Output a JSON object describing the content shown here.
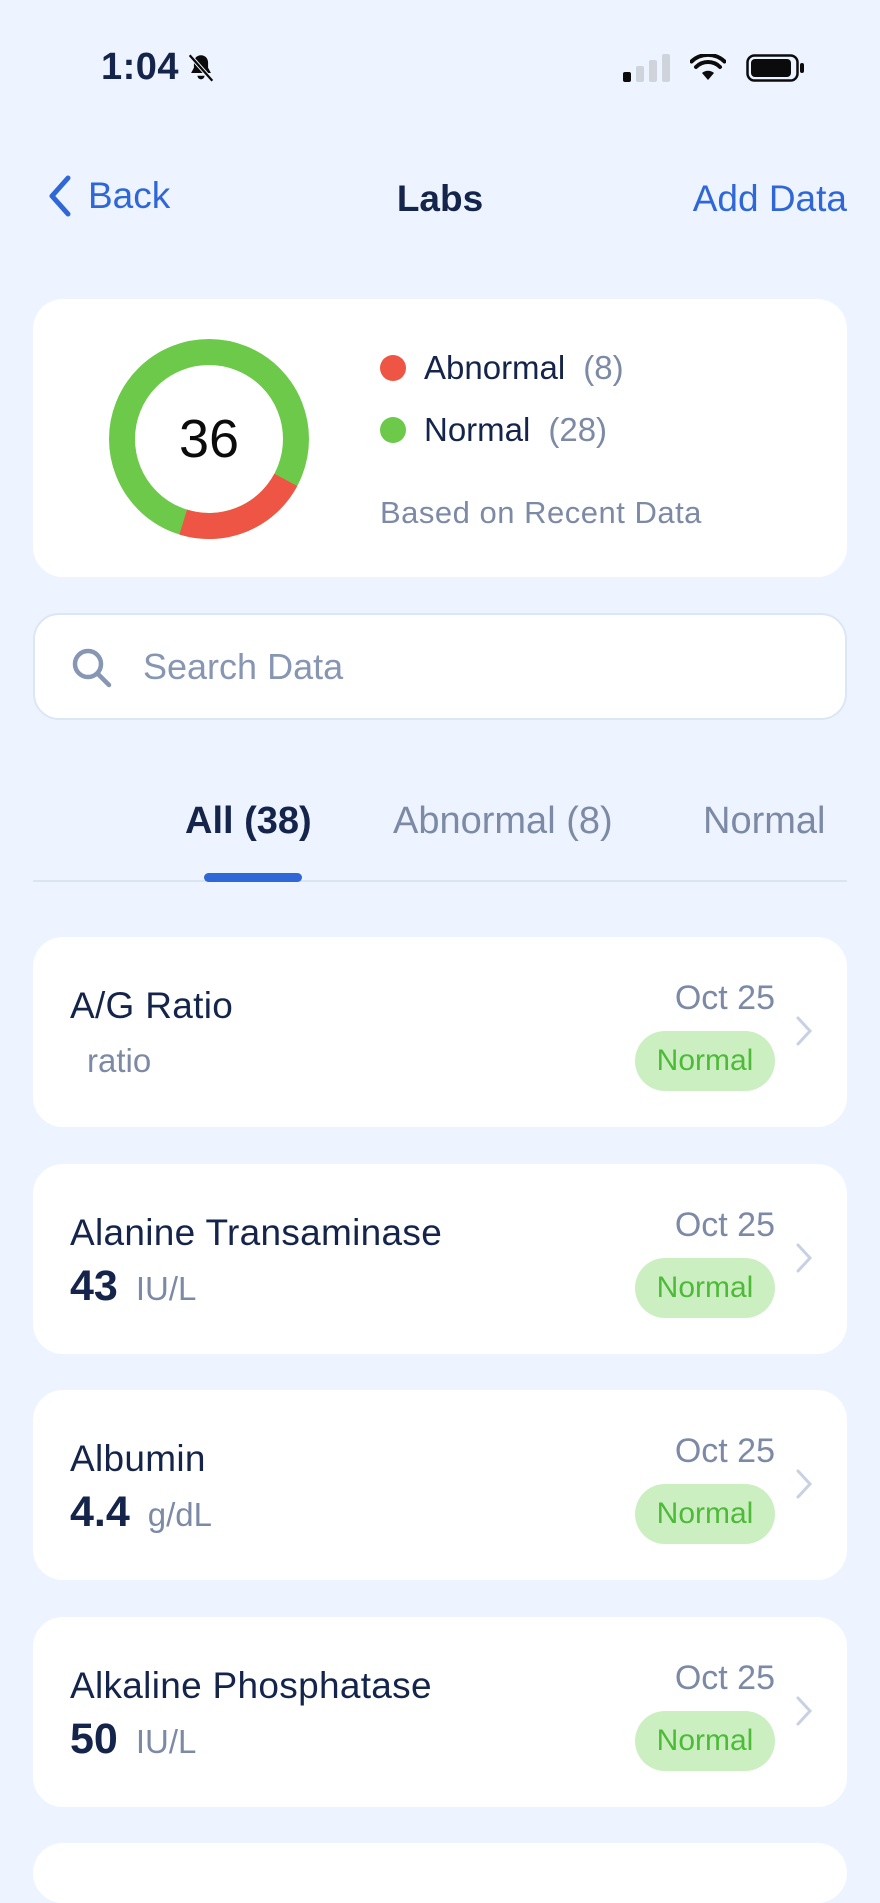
{
  "status": {
    "time": "1:04"
  },
  "nav": {
    "back_label": "Back",
    "title": "Labs",
    "add_label": "Add Data"
  },
  "summary": {
    "total": "36",
    "abnormal_label": "Abnormal",
    "abnormal_count": "(8)",
    "normal_label": "Normal",
    "normal_count": "(28)",
    "note": "Based on Recent Data",
    "abnormal_fraction": 0.22,
    "colors": {
      "abnormal": "#ef5545",
      "normal": "#6cc94a"
    }
  },
  "search": {
    "placeholder": "Search Data"
  },
  "tabs": [
    {
      "label": "All (38)",
      "active": true
    },
    {
      "label": "Abnormal (8)",
      "active": false
    },
    {
      "label": "Normal",
      "active": false
    }
  ],
  "labs": [
    {
      "name": "A/G Ratio",
      "value": "",
      "unit": "ratio",
      "date": "Oct 25",
      "status": "Normal"
    },
    {
      "name": "Alanine Transaminase",
      "value": "43",
      "unit": "IU/L",
      "date": "Oct 25",
      "status": "Normal"
    },
    {
      "name": "Albumin",
      "value": "4.4",
      "unit": "g/dL",
      "date": "Oct 25",
      "status": "Normal"
    },
    {
      "name": "Alkaline Phosphatase",
      "value": "50",
      "unit": "IU/L",
      "date": "Oct 25",
      "status": "Normal"
    }
  ]
}
